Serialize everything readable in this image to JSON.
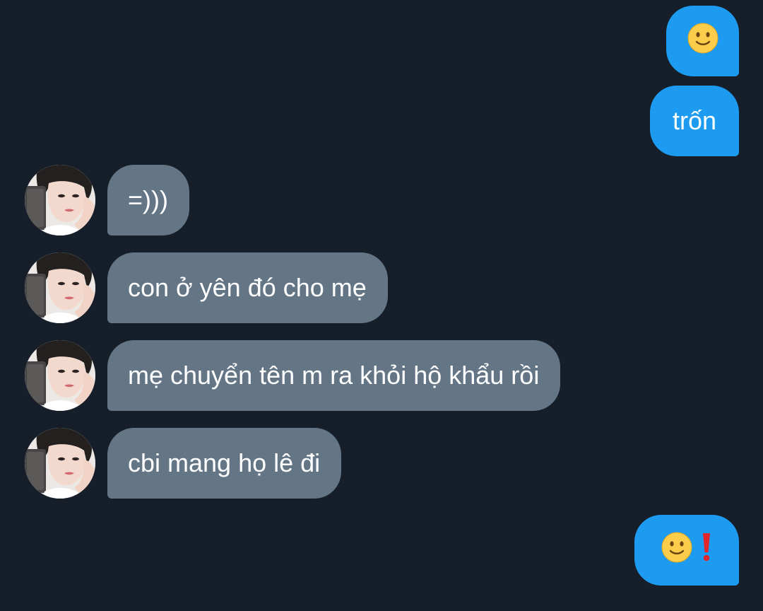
{
  "colors": {
    "background": "#151e29",
    "outgoing_bubble": "#1d9bf0",
    "incoming_bubble": "#647686",
    "text": "#ffffff"
  },
  "messages": [
    {
      "direction": "outgoing",
      "icons": [
        "slightly-smiling-face-icon"
      ]
    },
    {
      "direction": "outgoing",
      "text": "trốn"
    },
    {
      "direction": "incoming",
      "text": "=)))"
    },
    {
      "direction": "incoming",
      "text": "con ở yên đó cho mẹ"
    },
    {
      "direction": "incoming",
      "text": "mẹ chuyển tên m ra khỏi hộ khẩu rồi"
    },
    {
      "direction": "incoming",
      "text": "cbi mang họ lê đi"
    },
    {
      "direction": "outgoing",
      "icons": [
        "slightly-smiling-face-icon",
        "red-exclamation-mark-icon"
      ]
    }
  ]
}
